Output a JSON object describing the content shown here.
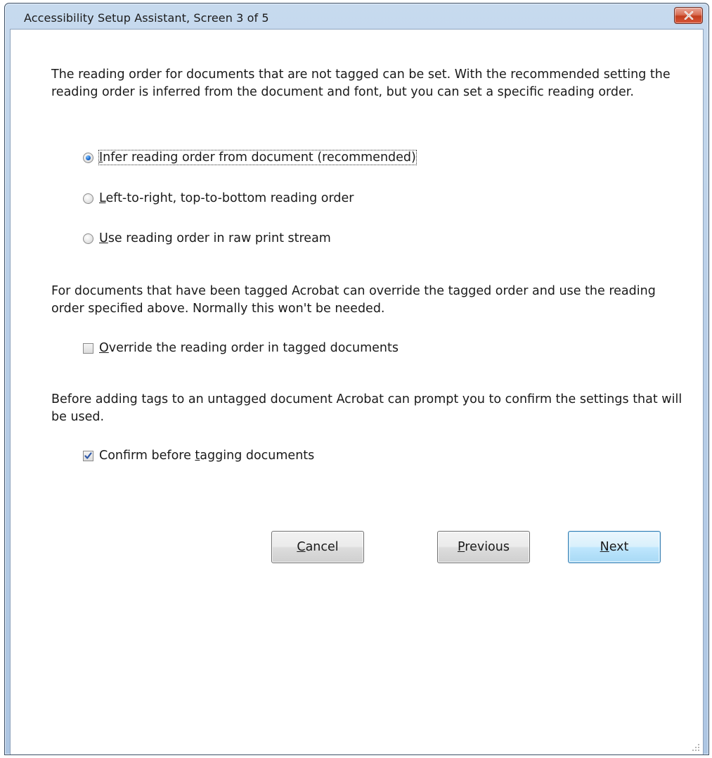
{
  "window": {
    "title": "Accessibility Setup Assistant, Screen 3 of 5"
  },
  "reading_order": {
    "description": "The reading order for documents that are not tagged can be set. With the recommended setting the reading order is inferred from the document and font, but you can set a specific reading order.",
    "options": [
      {
        "pre": "",
        "key": "I",
        "post": "nfer reading order from document (recommended)",
        "selected": true
      },
      {
        "pre": "",
        "key": "L",
        "post": "eft-to-right, top-to-bottom reading order",
        "selected": false
      },
      {
        "pre": "",
        "key": "U",
        "post": "se reading order in raw print stream",
        "selected": false
      }
    ]
  },
  "tagged_override": {
    "description": "For documents that have been tagged Acrobat can override the tagged order and use the reading order specified above. Normally this won't be needed.",
    "checkbox": {
      "pre": "",
      "key": "O",
      "post": "verride the reading order in tagged documents",
      "checked": false
    }
  },
  "confirm_tagging": {
    "description": "Before adding tags to an untagged document Acrobat can prompt you to confirm the settings that will be used.",
    "checkbox": {
      "pre": "Confirm before ",
      "key": "t",
      "post": "agging documents",
      "checked": true
    }
  },
  "buttons": {
    "cancel": {
      "pre": "",
      "key": "C",
      "post": "ancel"
    },
    "previous": {
      "pre": "",
      "key": "P",
      "post": "revious"
    },
    "next": {
      "pre": "",
      "key": "N",
      "post": "ext"
    }
  },
  "colors": {
    "title_bar": "#b9cfe8",
    "close_button": "#c23e1e",
    "default_button": "#bee6fd",
    "radio_dot": "#1a66c9",
    "check_mark": "#2e58a8"
  }
}
